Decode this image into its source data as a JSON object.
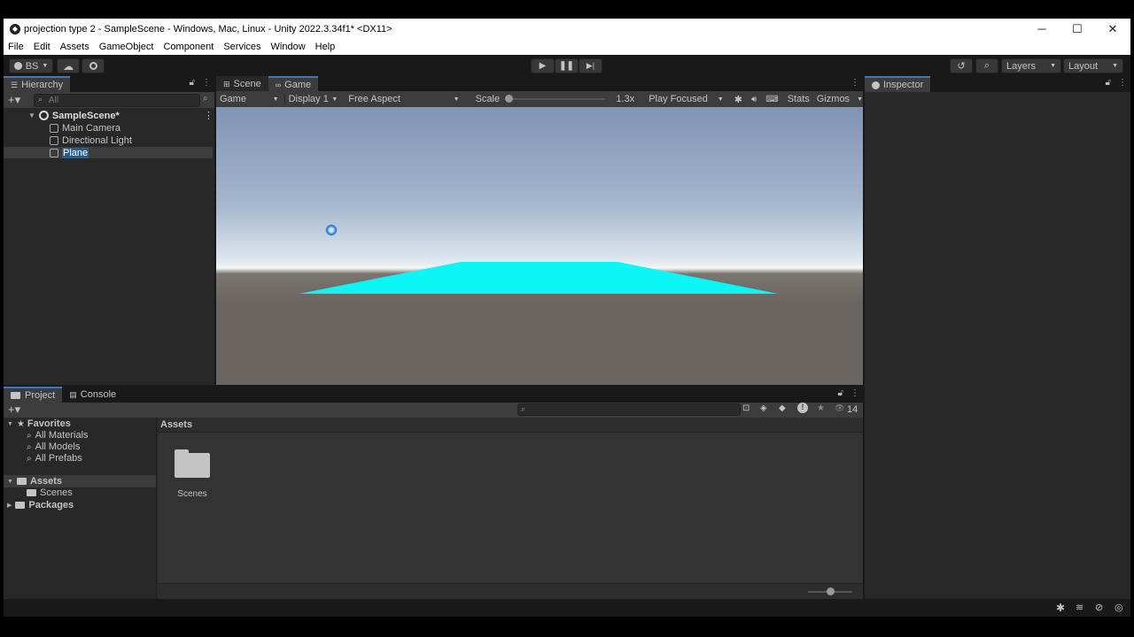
{
  "window": {
    "title": "projection type 2 - SampleScene - Windows, Mac, Linux - Unity 2022.3.34f1* <DX11>",
    "minimize": "─",
    "maximize": "☐",
    "close": "✕"
  },
  "menu": [
    "File",
    "Edit",
    "Assets",
    "GameObject",
    "Component",
    "Services",
    "Window",
    "Help"
  ],
  "toolbar": {
    "account": "BS",
    "layers_label": "Layers",
    "layout_label": "Layout"
  },
  "hierarchy": {
    "tab": "Hierarchy",
    "search_placeholder": "All",
    "scene": "SampleScene*",
    "items": [
      "Main Camera",
      "Directional Light",
      "Plane"
    ]
  },
  "scene_tabs": {
    "scene": "Scene",
    "game": "Game"
  },
  "game_toolbar": {
    "mode": "Game",
    "display": "Display 1",
    "aspect": "Free Aspect",
    "scale_label": "Scale",
    "scale_value": "1.3x",
    "scale_fraction": 0.0,
    "play_focused": "Play Focused",
    "stats": "Stats",
    "gizmos": "Gizmos"
  },
  "inspector": {
    "tab": "Inspector"
  },
  "project": {
    "tab_project": "Project",
    "tab_console": "Console",
    "hidden_count": "14",
    "favorites": "Favorites",
    "favorites_items": [
      "All Materials",
      "All Models",
      "All Prefabs"
    ],
    "assets_root": "Assets",
    "assets_children": [
      "Scenes"
    ],
    "packages": "Packages",
    "breadcrumb": "Assets",
    "asset_items": [
      "Scenes"
    ],
    "zoom_fraction": 0.5
  },
  "colors": {
    "plane": "#0cf6f6",
    "selection": "#2c5d87",
    "accent": "#3a79bb"
  }
}
